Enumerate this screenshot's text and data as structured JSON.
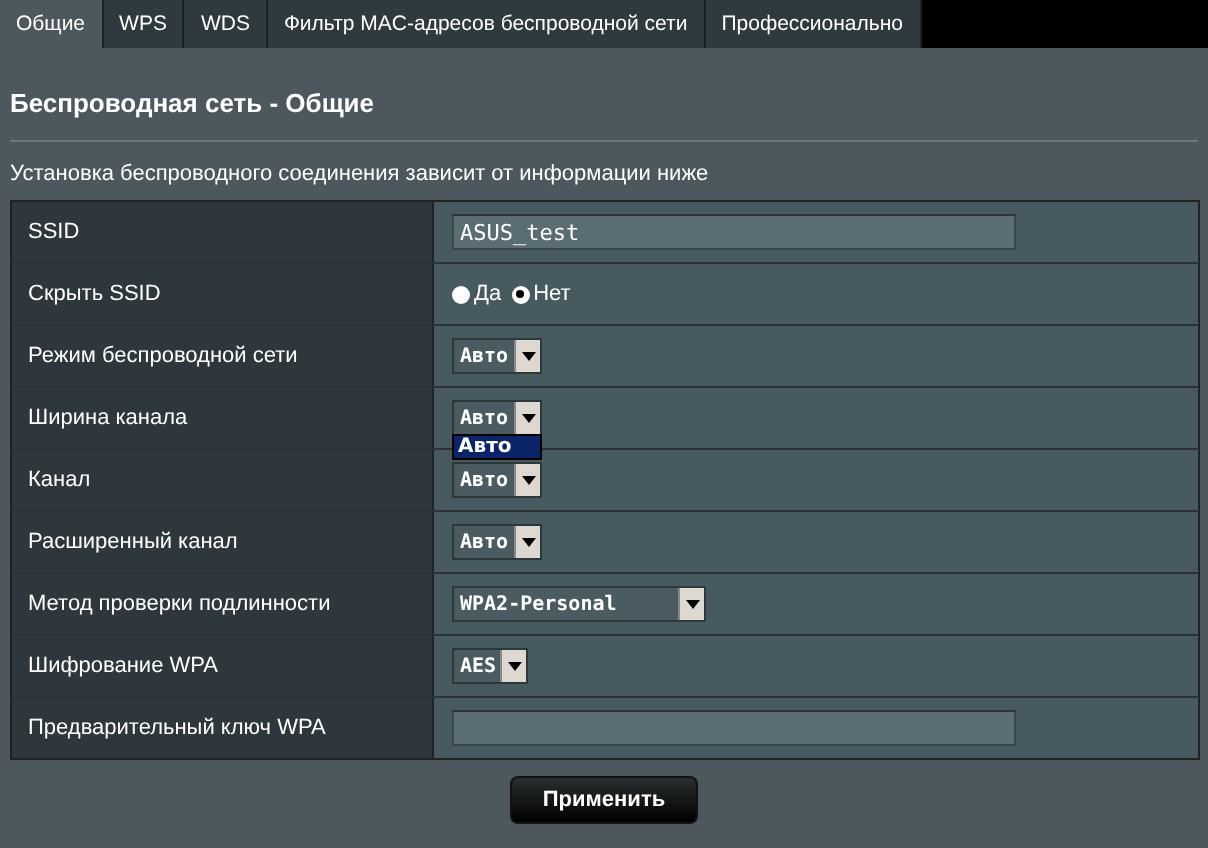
{
  "tabs": [
    {
      "label": "Общие",
      "selected": true
    },
    {
      "label": "WPS",
      "selected": false
    },
    {
      "label": "WDS",
      "selected": false
    },
    {
      "label": "Фильтр MAC-адресов беспроводной сети",
      "selected": false
    },
    {
      "label": "Профессионально",
      "selected": false
    }
  ],
  "title": "Беспроводная сеть - Общие",
  "description": "Установка беспроводного соединения зависит от информации ниже",
  "rows": [
    {
      "label": "SSID",
      "kind": "text",
      "value": "ASUS_test"
    },
    {
      "label": "Скрыть SSID",
      "kind": "radio",
      "options": [
        {
          "label": "Да",
          "selected": false
        },
        {
          "label": "Нет",
          "selected": true
        }
      ]
    },
    {
      "label": "Режим беспроводной сети",
      "kind": "select",
      "value": "Авто"
    },
    {
      "label": "Ширина канала",
      "kind": "select",
      "value": "Авто",
      "open_options": [
        {
          "label": "Авто",
          "selected": true
        }
      ]
    },
    {
      "label": "Канал",
      "kind": "select",
      "value": "Авто"
    },
    {
      "label": "Расширенный канал",
      "kind": "select",
      "value": "Авто"
    },
    {
      "label": "Метод проверки подлинности",
      "kind": "select",
      "value": "WPA2-Personal"
    },
    {
      "label": "Шифрование WPA",
      "kind": "select",
      "value": "AES"
    },
    {
      "label": "Предварительный ключ WPA",
      "kind": "text",
      "value": ""
    }
  ],
  "apply_button": "Применить"
}
